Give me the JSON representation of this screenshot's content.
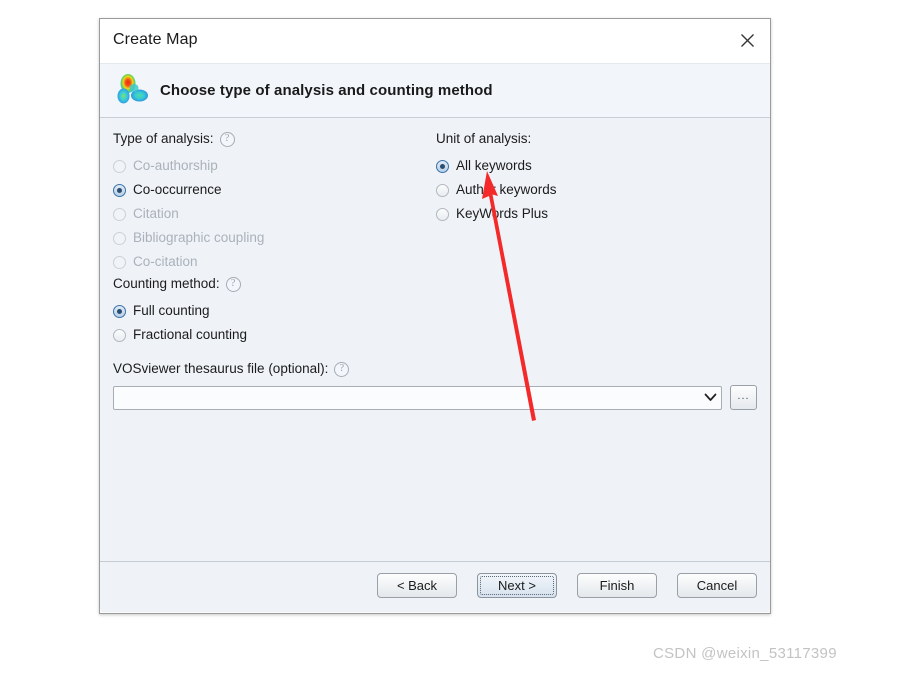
{
  "window": {
    "title": "Create Map",
    "close_icon": "close-icon"
  },
  "header": {
    "logo_icon": "vosviewer-density-logo-icon",
    "title": "Choose type of analysis and counting method"
  },
  "type_of_analysis": {
    "label": "Type of analysis:",
    "help_icon": "help-circle-icon",
    "options": [
      {
        "label": "Co-authorship",
        "checked": false,
        "disabled": true
      },
      {
        "label": "Co-occurrence",
        "checked": true,
        "disabled": false
      },
      {
        "label": "Citation",
        "checked": false,
        "disabled": true
      },
      {
        "label": "Bibliographic coupling",
        "checked": false,
        "disabled": true
      },
      {
        "label": "Co-citation",
        "checked": false,
        "disabled": true
      }
    ]
  },
  "unit_of_analysis": {
    "label": "Unit of analysis:",
    "options": [
      {
        "label": "All keywords",
        "checked": true,
        "disabled": false
      },
      {
        "label": "Author keywords",
        "checked": false,
        "disabled": false
      },
      {
        "label": "KeyWords Plus",
        "checked": false,
        "disabled": false
      }
    ]
  },
  "counting_method": {
    "label": "Counting method:",
    "help_icon": "help-circle-icon",
    "options": [
      {
        "label": "Full counting",
        "checked": true,
        "disabled": false
      },
      {
        "label": "Fractional counting",
        "checked": false,
        "disabled": false
      }
    ]
  },
  "thesaurus": {
    "label": "VOSviewer thesaurus file (optional):",
    "help_icon": "help-circle-icon",
    "value": "",
    "placeholder": "",
    "dropdown_icon": "chevron-down-icon",
    "browse_label": "...",
    "browse_icon": "ellipsis-icon"
  },
  "footer": {
    "back_label": "< Back",
    "next_label": "Next >",
    "finish_label": "Finish",
    "cancel_label": "Cancel"
  },
  "annotation": {
    "arrow_color": "#f42a2a",
    "arrow_name": "red-pointer-arrow"
  },
  "watermark": {
    "text": "CSDN @weixin_53117399"
  }
}
